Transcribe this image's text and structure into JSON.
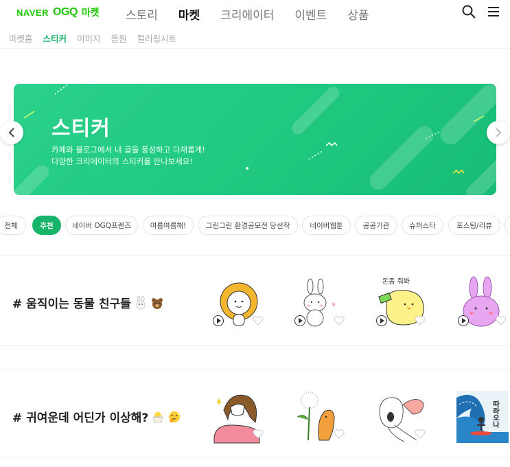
{
  "header": {
    "logo": {
      "naver": "NAVER",
      "ogq": "OGQ",
      "market": "마켓"
    },
    "nav": [
      {
        "label": "스토리",
        "active": false
      },
      {
        "label": "마켓",
        "active": true
      },
      {
        "label": "크리에이터",
        "active": false
      },
      {
        "label": "이벤트",
        "active": false
      },
      {
        "label": "상품",
        "active": false
      }
    ],
    "icons": [
      "search-icon",
      "menu-icon"
    ]
  },
  "subnav": [
    {
      "label": "마켓홈",
      "active": false
    },
    {
      "label": "스티커",
      "active": true
    },
    {
      "label": "이미지",
      "active": false
    },
    {
      "label": "음원",
      "active": false
    },
    {
      "label": "컬러링시트",
      "active": false
    }
  ],
  "banner": {
    "title": "스티커",
    "line1": "카페와 블로그에서 내 글을 풍성하고 다채롭게!",
    "line2": "다양한 크리에이터의 스티커를 만나보세요!",
    "color": "#22c983"
  },
  "chips": [
    {
      "label": "전체",
      "active": false
    },
    {
      "label": "추천",
      "active": true
    },
    {
      "label": "네이버 OGQ프렌즈",
      "active": false
    },
    {
      "label": "여름여름해!",
      "active": false
    },
    {
      "label": "그린그린 환경공모전 당선작",
      "active": false
    },
    {
      "label": "네이버웹툰",
      "active": false
    },
    {
      "label": "공공기관",
      "active": false
    },
    {
      "label": "슈퍼스타",
      "active": false
    },
    {
      "label": "포스팅/리뷰",
      "active": false
    }
  ],
  "sections": [
    {
      "title": "# 움직이는 동물 친구들",
      "emoji": [
        "rabbit-emoji",
        "bear-emoji"
      ],
      "stickers": [
        "lion",
        "rabbit-white",
        "chick-money",
        "pink-bunny"
      ],
      "sticker_text": "돈좀 줘봐"
    },
    {
      "title": "# 귀여운데 어딘가 이상해?",
      "emoji": [
        "hatching-chick-emoji",
        "thinking-face-emoji"
      ],
      "stickers": [
        "long-hair-girl",
        "dandelion-worm",
        "screaming-face",
        "surfer-wave"
      ],
      "sticker_text": "따라오나"
    }
  ],
  "accent": "#19b46b"
}
